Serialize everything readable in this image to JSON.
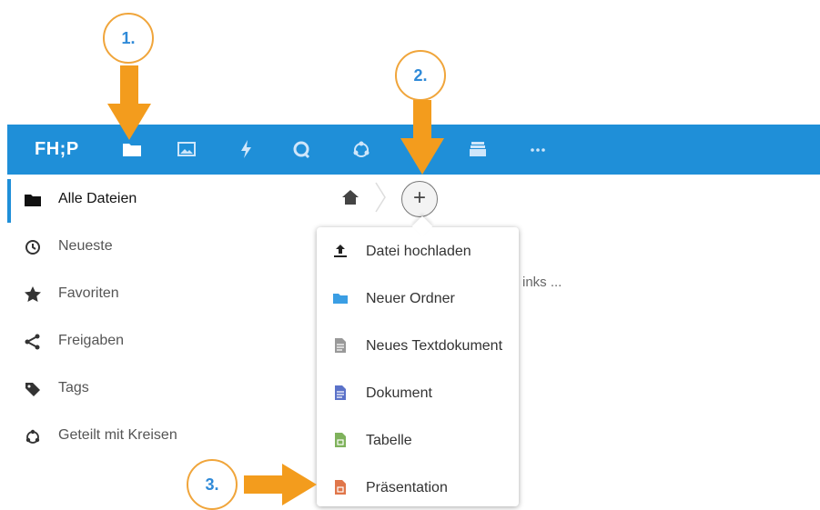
{
  "topbar": {
    "logo": "FH;P",
    "apps": [
      {
        "icon": "folder-icon"
      },
      {
        "icon": "image-icon"
      },
      {
        "icon": "lightning-icon"
      },
      {
        "icon": "search-circle-icon"
      },
      {
        "icon": "circles-icon"
      },
      {
        "icon": "contacts-icon"
      },
      {
        "icon": "deck-icon"
      },
      {
        "icon": "more-icon",
        "label": "···"
      }
    ]
  },
  "sidebar": {
    "items": [
      {
        "label": "Alle Dateien",
        "icon": "folder-icon"
      },
      {
        "label": "Neueste",
        "icon": "clock-icon"
      },
      {
        "label": "Favoriten",
        "icon": "star-icon"
      },
      {
        "label": "Freigaben",
        "icon": "share-icon"
      },
      {
        "label": "Tags",
        "icon": "tag-icon"
      },
      {
        "label": "Geteilt mit Kreisen",
        "icon": "circles-icon"
      }
    ]
  },
  "breadcrumb": {
    "add_label": "+"
  },
  "background_text": "inks ...",
  "menu": {
    "items": [
      {
        "label": "Datei hochladen",
        "icon": "upload-icon"
      },
      {
        "label": "Neuer Ordner",
        "icon": "folder-icon"
      },
      {
        "label": "Neues Textdokument",
        "icon": "text-file-icon"
      },
      {
        "label": "Dokument",
        "icon": "document-icon"
      },
      {
        "label": "Tabelle",
        "icon": "spreadsheet-icon"
      },
      {
        "label": "Präsentation",
        "icon": "presentation-icon"
      }
    ]
  },
  "annotations": {
    "step1": "1.",
    "step2": "2.",
    "step3": "3."
  },
  "colors": {
    "header": "#1f8fd8",
    "annotation_orange": "#f39c1d",
    "annotation_text": "#2f8ad8"
  }
}
